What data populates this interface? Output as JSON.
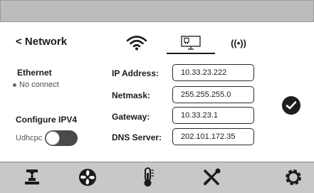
{
  "header": {
    "back_label": "< Network"
  },
  "tabs": [
    {
      "name": "wifi",
      "icon": "wifi-icon",
      "active": false
    },
    {
      "name": "ethernet",
      "icon": "ethernet-icon",
      "active": true
    },
    {
      "name": "hotspot",
      "icon": "hotspot-icon",
      "label": "((•))",
      "active": false
    }
  ],
  "ethernet": {
    "title": "Ethernet",
    "status": "No connect"
  },
  "config": {
    "title": "Configure IPV4",
    "udhcpc_label": "Udhcpc",
    "udhcpc_enabled": false
  },
  "fields": {
    "ip": {
      "label": "IP Address:",
      "value": "10.33.23.222"
    },
    "netmask": {
      "label": "Netmask:",
      "value": "255.255.255.0"
    },
    "gateway": {
      "label": "Gateway:",
      "value": "10.33.23.1"
    },
    "dns": {
      "label": "DNS Server:",
      "value": "202.101.172.35"
    }
  },
  "nav": [
    {
      "name": "print",
      "icon": "print-bed-icon"
    },
    {
      "name": "fan",
      "icon": "fan-icon"
    },
    {
      "name": "temperature",
      "icon": "thermometer-icon"
    },
    {
      "name": "tools",
      "icon": "tools-icon"
    },
    {
      "name": "settings",
      "icon": "gear-icon"
    }
  ],
  "colors": {
    "topbar": "#bcbcbc",
    "bottombar": "#c8c8c8",
    "text": "#1b1b1b",
    "toggle": "#4a4a4a"
  }
}
